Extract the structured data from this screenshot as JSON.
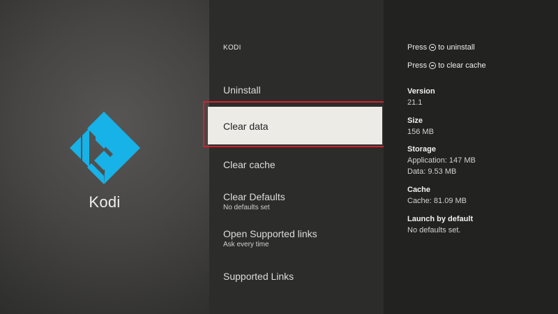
{
  "app": {
    "name": "Kodi",
    "icon": "kodi-logo-icon",
    "brand_color": "#17b2e7"
  },
  "menu": {
    "title": "KODI",
    "items": [
      {
        "label": "Uninstall",
        "sub": ""
      },
      {
        "label": "Clear data",
        "sub": "",
        "selected": true
      },
      {
        "label": "Clear cache",
        "sub": ""
      },
      {
        "label": "Clear Defaults",
        "sub": "No defaults set"
      },
      {
        "label": "Open Supported links",
        "sub": "Ask every time"
      },
      {
        "label": "Supported Links",
        "sub": ""
      }
    ],
    "highlight_color": "#cf2330"
  },
  "hints": [
    {
      "prefix": "Press",
      "icon": "remote-menu-icon",
      "suffix": "to uninstall"
    },
    {
      "prefix": "Press",
      "icon": "remote-menu-icon",
      "suffix": "to clear cache"
    }
  ],
  "info": {
    "version_label": "Version",
    "version_value": "21.1",
    "size_label": "Size",
    "size_value": "156 MB",
    "storage_label": "Storage",
    "storage_application": "Application: 147 MB",
    "storage_data": "Data: 9.53 MB",
    "cache_label": "Cache",
    "cache_value": "Cache: 81.09 MB",
    "launch_label": "Launch by default",
    "launch_value": "No defaults set."
  }
}
